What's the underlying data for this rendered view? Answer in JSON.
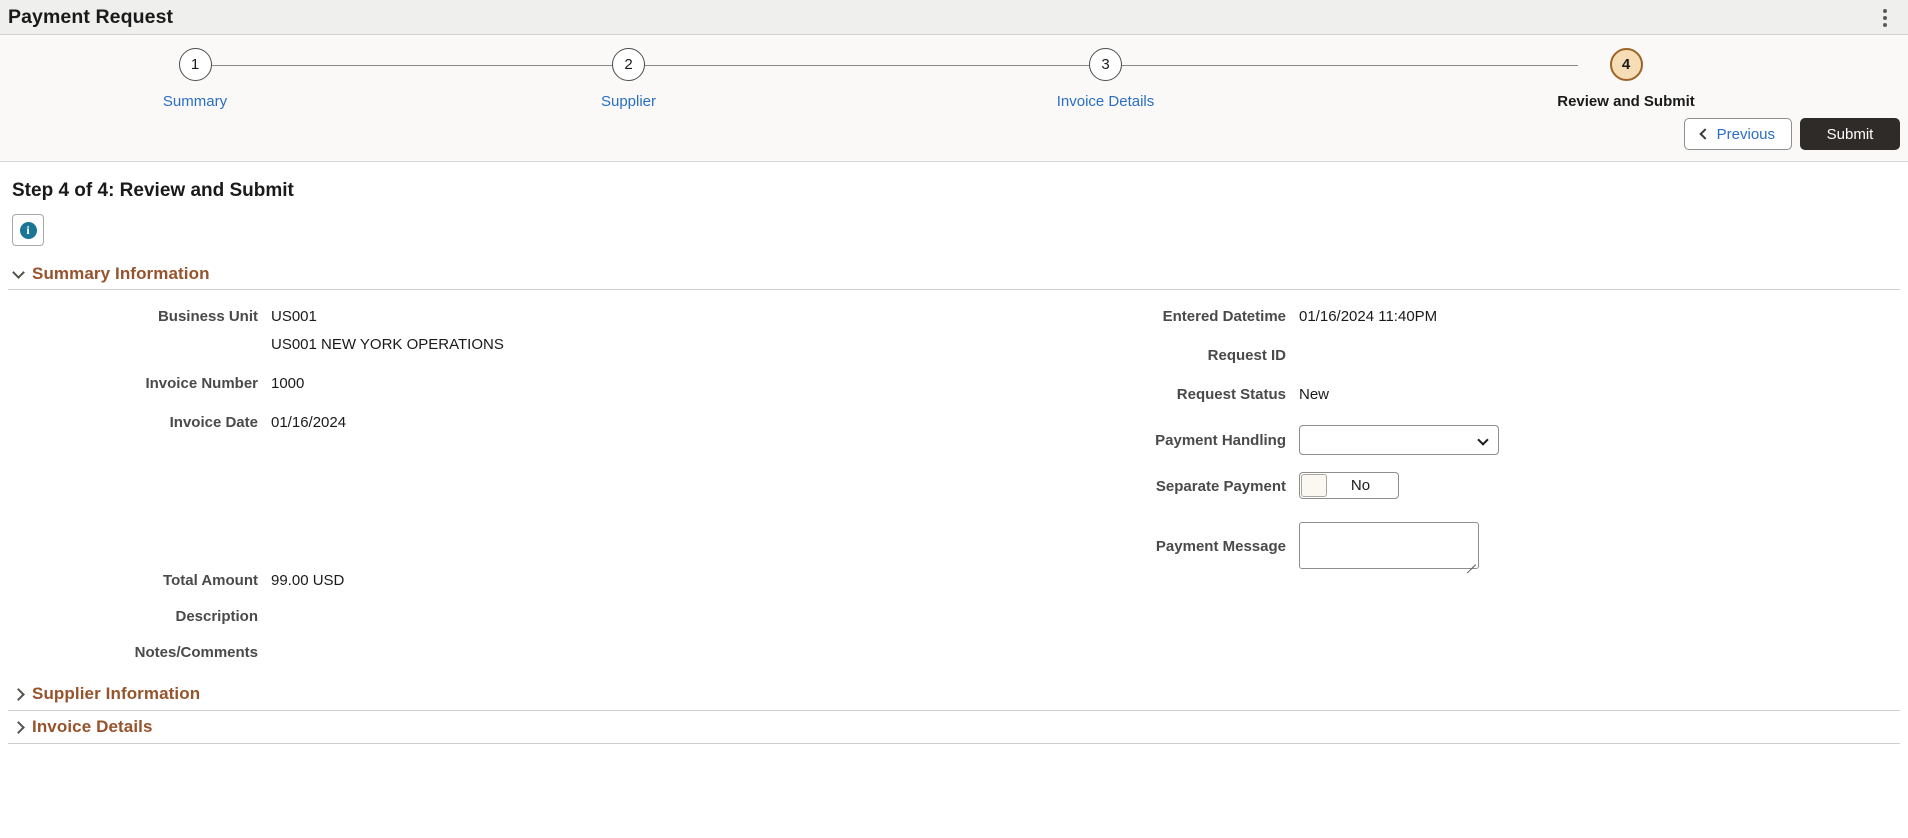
{
  "header": {
    "title": "Payment Request",
    "menu_icon": "kebab-menu-icon"
  },
  "stepper": {
    "steps": [
      {
        "number": "1",
        "label": "Summary",
        "state": "done"
      },
      {
        "number": "2",
        "label": "Supplier",
        "state": "done"
      },
      {
        "number": "3",
        "label": "Invoice Details",
        "state": "done"
      },
      {
        "number": "4",
        "label": "Review and Submit",
        "state": "current"
      }
    ],
    "current_color": "#f7ddb6",
    "current_border": "#9a6426",
    "link_color": "#2a6fc4"
  },
  "actions": {
    "previous_label": "Previous",
    "previous_icon": "chevron-left-icon",
    "submit_label": "Submit",
    "submit_bg": "#2f2b28"
  },
  "page": {
    "title": "Step 4 of 4: Review and Submit",
    "info_icon": "info-icon",
    "info_icon_color": "#1a7596"
  },
  "summary_section": {
    "title": "Summary Information",
    "expanded": true,
    "title_color": "#96532c",
    "left_fields": [
      {
        "label": "Business Unit",
        "value": "US001",
        "sub_value": "US001 NEW YORK OPERATIONS"
      },
      {
        "label": "Invoice Number",
        "value": "1000"
      },
      {
        "label": "Invoice Date",
        "value": "01/16/2024"
      }
    ],
    "left_fields_lower": [
      {
        "label": "Total Amount",
        "value": "99.00 USD"
      },
      {
        "label": "Description",
        "value": ""
      },
      {
        "label": "Notes/Comments",
        "value": ""
      }
    ],
    "right_fields": [
      {
        "label": "Entered Datetime",
        "value": "01/16/2024 11:40PM"
      },
      {
        "label": "Request ID",
        "value": ""
      },
      {
        "label": "Request Status",
        "value": "New"
      }
    ],
    "payment_handling": {
      "label": "Payment Handling",
      "value": "",
      "options": [
        ""
      ]
    },
    "separate_payment": {
      "label": "Separate Payment",
      "value": "No"
    },
    "payment_message": {
      "label": "Payment Message",
      "value": ""
    }
  },
  "collapsed_sections": [
    {
      "title": "Supplier Information",
      "expanded": false
    },
    {
      "title": "Invoice Details",
      "expanded": false
    }
  ]
}
